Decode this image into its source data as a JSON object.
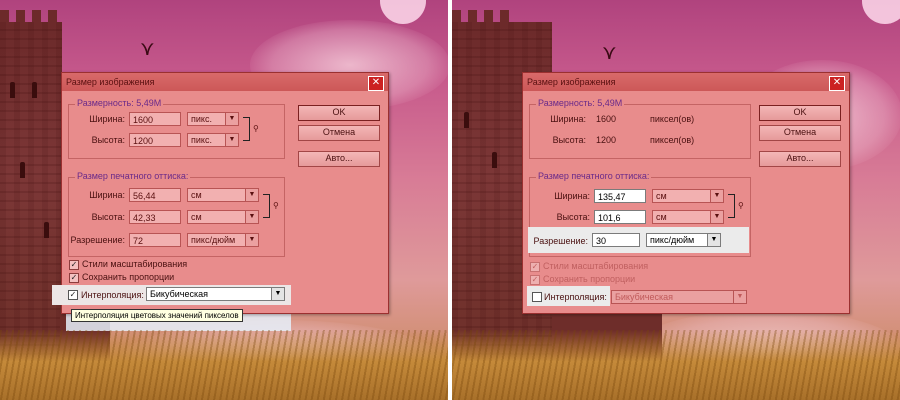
{
  "dialog_title": "Размер изображения",
  "colors": {
    "accent": "#e88c8c",
    "title_accent": "#6a2a8a",
    "close_red": "#cc2222"
  },
  "left": {
    "dimensions": {
      "title": "Размерность:",
      "size": "5,49M"
    },
    "width": {
      "label": "Ширина:",
      "value": "1600",
      "unit": "пикс."
    },
    "height": {
      "label": "Высота:",
      "value": "1200",
      "unit": "пикс."
    },
    "print": {
      "title": "Размер печатного оттиска:",
      "width": {
        "label": "Ширина:",
        "value": "56,44",
        "unit": "см"
      },
      "height": {
        "label": "Высота:",
        "value": "42,33",
        "unit": "см"
      },
      "resolution": {
        "label": "Разрешение:",
        "value": "72",
        "unit": "пикс/дюйм"
      }
    },
    "checkboxes": [
      {
        "label": "Стили масштабирования",
        "checked": true
      },
      {
        "label": "Сохранить пропорции",
        "checked": true
      },
      {
        "label": "Интерполяция:",
        "checked": true
      }
    ],
    "interpolation": "Бикубическая",
    "tooltip": "Интерполяция цветовых значений пикселов"
  },
  "right": {
    "dimensions": {
      "title": "Размерность:",
      "size": "5,49M"
    },
    "width": {
      "label": "Ширина:",
      "value": "1600",
      "unit": "пиксел(ов)"
    },
    "height": {
      "label": "Высота:",
      "value": "1200",
      "unit": "пиксел(ов)"
    },
    "print": {
      "title": "Размер печатного оттиска:",
      "width": {
        "label": "Ширина:",
        "value": "135,47",
        "unit": "см"
      },
      "height": {
        "label": "Высота:",
        "value": "101,6",
        "unit": "см"
      },
      "resolution": {
        "label": "Разрешение:",
        "value": "30",
        "unit": "пикс/дюйм"
      }
    },
    "checkboxes": [
      {
        "label": "Стили масштабирования",
        "checked": true
      },
      {
        "label": "Сохранить пропорции",
        "checked": true
      },
      {
        "label": "Интерполяция:",
        "checked": false
      }
    ],
    "interpolation": "Бикубическая"
  },
  "buttons": {
    "ok": "OK",
    "cancel": "Отмена",
    "auto": "Авто..."
  },
  "icons": {
    "close": "close-icon",
    "link": "chain-link-icon",
    "dropdown": "chevron-down-icon"
  }
}
